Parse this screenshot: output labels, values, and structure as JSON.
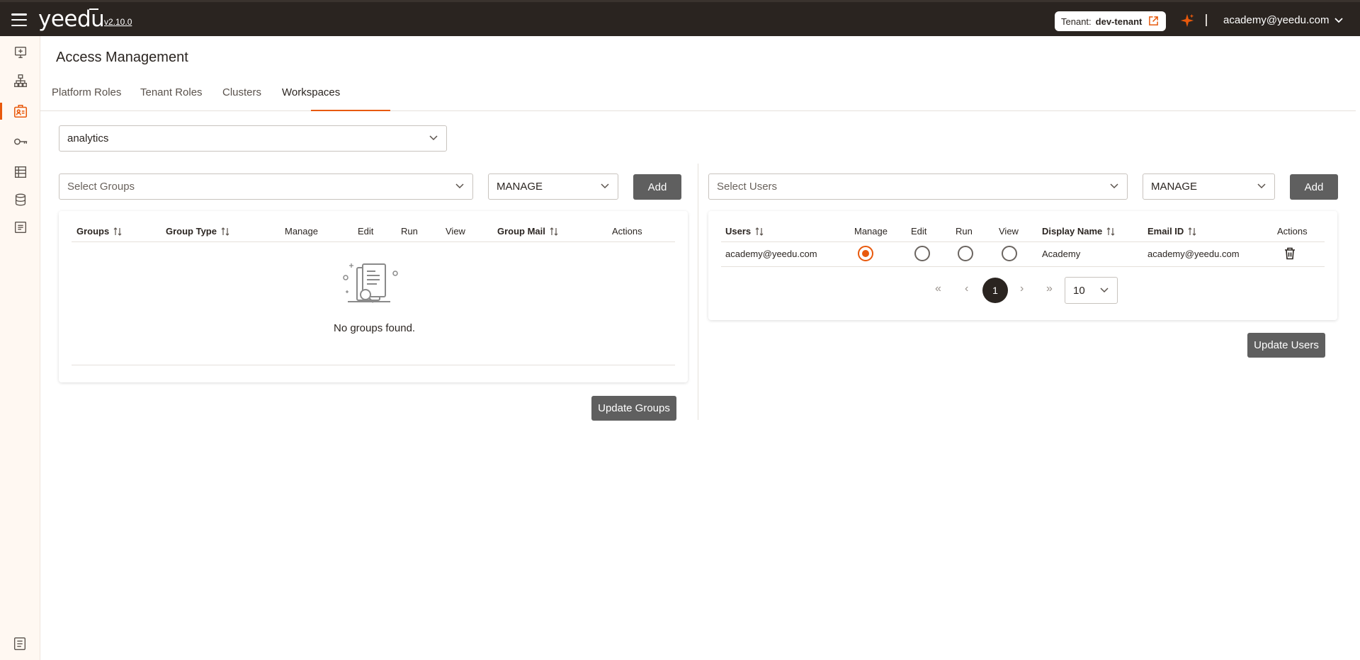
{
  "header": {
    "brand": "yeedu",
    "version": "v2.10.0",
    "tenant_label": "Tenant:",
    "tenant_name": "dev-tenant",
    "user_email": "academy@yeedu.com"
  },
  "sidebar": {
    "items": [
      "monitor-plus-icon",
      "hierarchy-icon",
      "access-management-icon",
      "key-icon",
      "workspace-icon",
      "database-icon",
      "receipt-icon"
    ],
    "active": "access-management-icon",
    "bottom": "document-icon"
  },
  "page": {
    "title": "Access Management",
    "tabs": [
      "Platform Roles",
      "Tenant Roles",
      "Clusters",
      "Workspaces"
    ],
    "active_tab": "Workspaces",
    "workspace_select": "analytics"
  },
  "groups_panel": {
    "select_placeholder": "Select Groups",
    "permission": "MANAGE",
    "add_label": "Add",
    "columns": [
      "Groups",
      "Group Type",
      "Manage",
      "Edit",
      "Run",
      "View",
      "Group Mail",
      "Actions"
    ],
    "empty_text": "No groups found.",
    "update_label": "Update Groups"
  },
  "users_panel": {
    "select_placeholder": "Select Users",
    "permission": "MANAGE",
    "add_label": "Add",
    "columns": [
      "Users",
      "Manage",
      "Edit",
      "Run",
      "View",
      "Display Name",
      "Email ID",
      "Actions"
    ],
    "rows": [
      {
        "user": "academy@yeedu.com",
        "permission": "Manage",
        "display_name": "Academy",
        "email": "academy@yeedu.com"
      }
    ],
    "pagination": {
      "current_page": "1",
      "page_size": "10"
    },
    "update_label": "Update Users"
  },
  "colors": {
    "accent": "#e8590c",
    "header_bg": "#2a2420",
    "button_bg": "#5f5f5f"
  }
}
